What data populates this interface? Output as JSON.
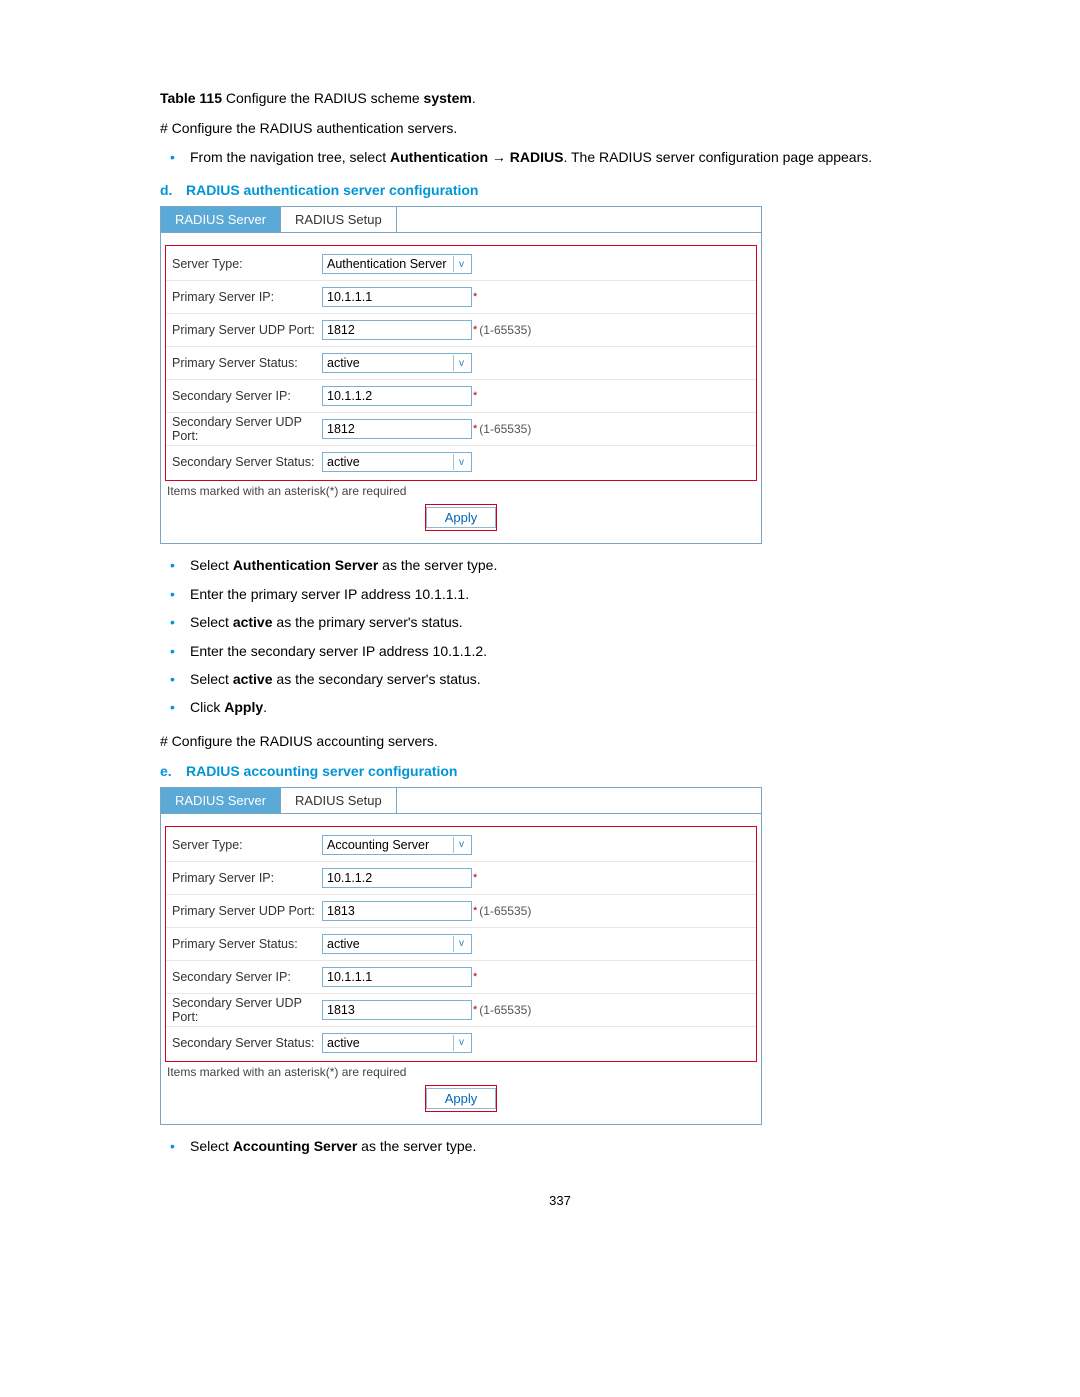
{
  "caption": {
    "prefix": "Table 115",
    "mid": " Configure the RADIUS scheme ",
    "bold": "system",
    "suffix": "."
  },
  "hash1": "# Configure the RADIUS authentication servers.",
  "nav_bullet": {
    "pre": "From the navigation tree, select ",
    "b1": "Authentication",
    "arrow": " → ",
    "b2": "RADIUS",
    "post": ". The RADIUS server configuration page appears."
  },
  "heading_d": {
    "letter": "d.",
    "text": "RADIUS authentication server configuration"
  },
  "tabs": {
    "active": "RADIUS Server",
    "other": "RADIUS Setup"
  },
  "form1": {
    "rows": [
      {
        "label": "Server Type:",
        "type": "select",
        "value": "Authentication Server"
      },
      {
        "label": "Primary Server IP:",
        "type": "text",
        "value": "10.1.1.1",
        "req": "*"
      },
      {
        "label": "Primary Server UDP Port:",
        "type": "text",
        "value": "1812",
        "req": "*",
        "hint": "(1-65535)"
      },
      {
        "label": "Primary Server Status:",
        "type": "select",
        "value": "active"
      },
      {
        "label": "Secondary Server IP:",
        "type": "text",
        "value": "10.1.1.2",
        "req": "*"
      },
      {
        "label": "Secondary Server UDP Port:",
        "type": "text",
        "value": "1812",
        "req": "*",
        "hint": "(1-65535)"
      },
      {
        "label": "Secondary Server Status:",
        "type": "select",
        "value": "active"
      }
    ]
  },
  "req_note": "Items marked with an asterisk(*) are required",
  "apply": "Apply",
  "bullets_mid": [
    {
      "pre": "Select ",
      "b": "Authentication Server",
      "post": " as the server type."
    },
    {
      "pre": "Enter the primary server IP address 10.1.1.1.",
      "b": "",
      "post": ""
    },
    {
      "pre": "Select ",
      "b": "active",
      "post": " as the primary server's status."
    },
    {
      "pre": "Enter the secondary server IP address 10.1.1.2.",
      "b": "",
      "post": ""
    },
    {
      "pre": "Select ",
      "b": "active",
      "post": " as the secondary server's status."
    },
    {
      "pre": "Click ",
      "b": "Apply",
      "post": "."
    }
  ],
  "hash2": "# Configure the RADIUS accounting servers.",
  "heading_e": {
    "letter": "e.",
    "text": "RADIUS accounting server configuration"
  },
  "form2": {
    "rows": [
      {
        "label": "Server Type:",
        "type": "select",
        "value": "Accounting Server"
      },
      {
        "label": "Primary Server IP:",
        "type": "text",
        "value": "10.1.1.2",
        "req": "*"
      },
      {
        "label": "Primary Server UDP Port:",
        "type": "text",
        "value": "1813",
        "req": "*",
        "hint": "(1-65535)"
      },
      {
        "label": "Primary Server Status:",
        "type": "select",
        "value": "active"
      },
      {
        "label": "Secondary Server IP:",
        "type": "text",
        "value": "10.1.1.1",
        "req": "*"
      },
      {
        "label": "Secondary Server UDP Port:",
        "type": "text",
        "value": "1813",
        "req": "*",
        "hint": "(1-65535)"
      },
      {
        "label": "Secondary Server Status:",
        "type": "select",
        "value": "active"
      }
    ]
  },
  "bullets_end": [
    {
      "pre": "Select ",
      "b": "Accounting Server",
      "post": " as the server type."
    }
  ],
  "page_number": "337"
}
